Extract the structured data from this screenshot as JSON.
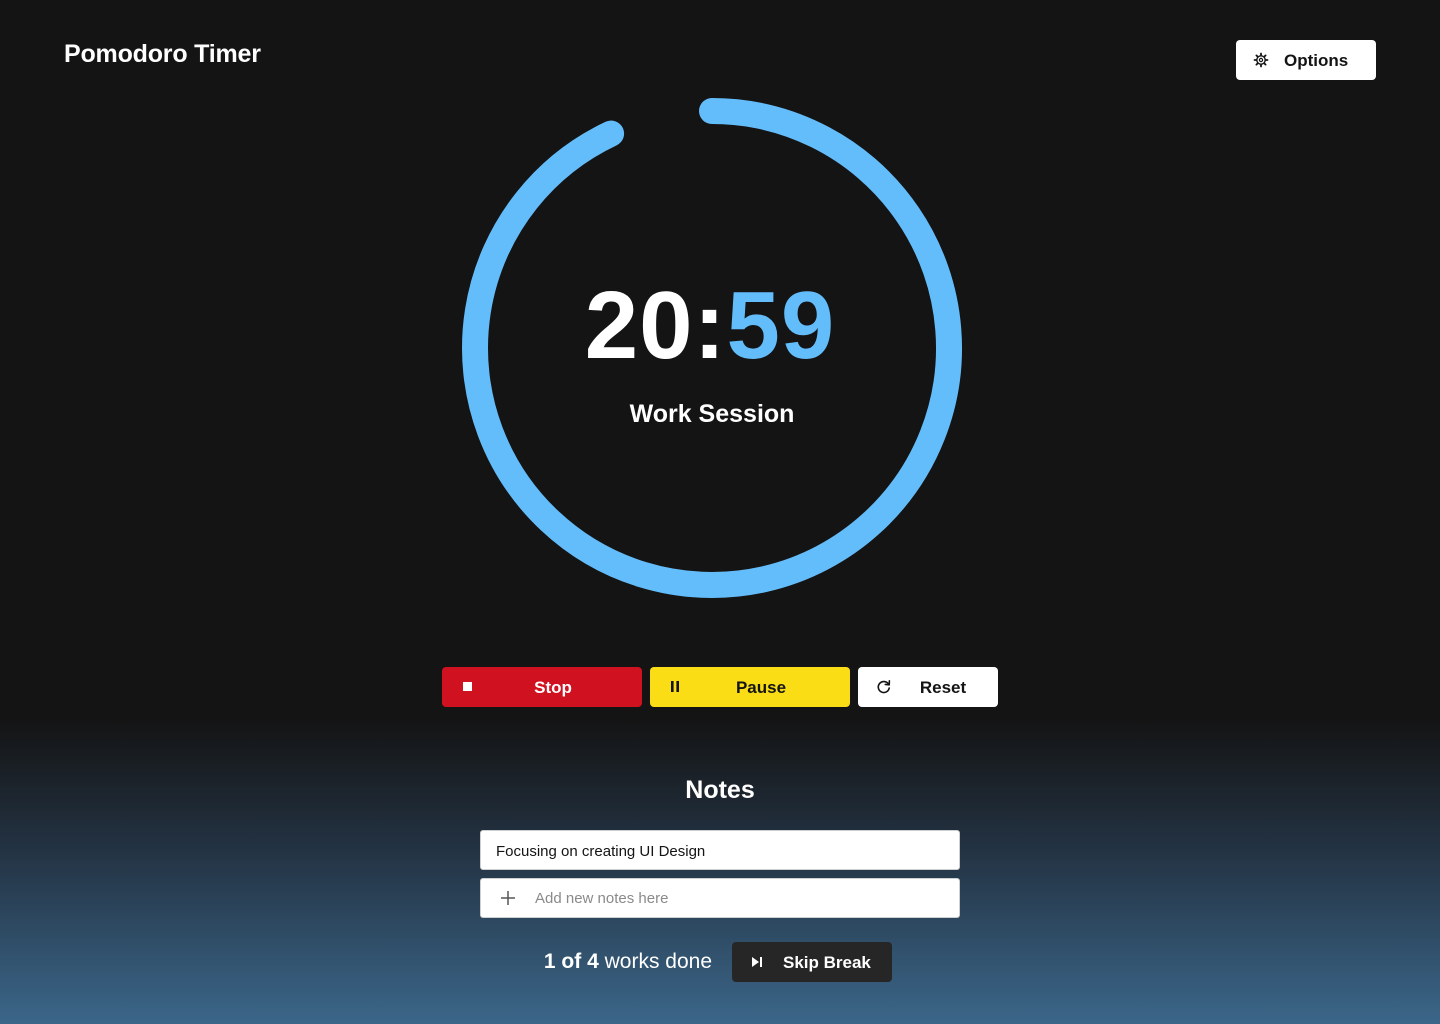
{
  "app": {
    "title": "Pomodoro Timer"
  },
  "header": {
    "options_label": "Options"
  },
  "timer": {
    "minutes": "20",
    "separator": ":",
    "seconds": "59",
    "session_label": "Work Session",
    "progress_fraction": 0.93,
    "ring_color": "#64bdfb"
  },
  "controls": {
    "stop_label": "Stop",
    "pause_label": "Pause",
    "reset_label": "Reset",
    "stop_color": "#d0111f",
    "pause_color": "#fadd15"
  },
  "notes": {
    "title": "Notes",
    "items": [
      "Focusing on creating UI Design"
    ],
    "placeholder": "Add new notes here"
  },
  "footer": {
    "done_count": "1 of 4",
    "done_suffix": "works done",
    "skip_label": "Skip Break"
  }
}
